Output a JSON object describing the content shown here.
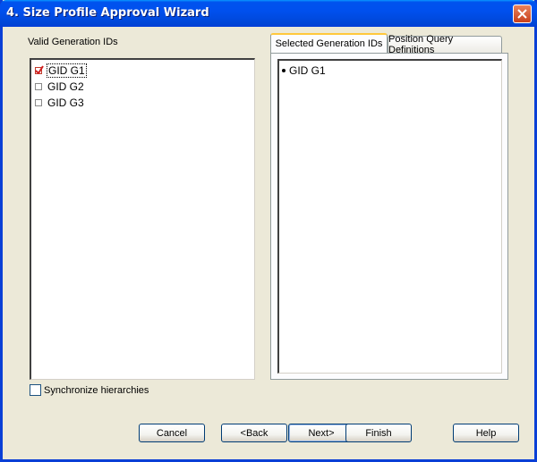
{
  "window": {
    "title": "4. Size Profile Approval Wizard"
  },
  "left_panel": {
    "label": "Valid Generation IDs",
    "items": [
      {
        "label": "GID G1",
        "checked": true,
        "focused": true
      },
      {
        "label": "GID G2",
        "checked": false
      },
      {
        "label": "GID G3",
        "checked": false
      }
    ]
  },
  "sync": {
    "label": "Synchronize hierarchies",
    "checked": false
  },
  "tabs": [
    {
      "label": "Selected Generation IDs",
      "active": true
    },
    {
      "label": "Position Query Definitions",
      "active": false
    }
  ],
  "selected_list": [
    "GID G1"
  ],
  "buttons": {
    "cancel": "Cancel",
    "back": "<Back",
    "next": "Next>",
    "finish": "Finish",
    "help": "Help"
  },
  "colors": {
    "titlebar": "#0050ee",
    "window_bg": "#ece9d8",
    "close_button": "#c8401c",
    "active_tab_accent": "#ffc83c"
  }
}
